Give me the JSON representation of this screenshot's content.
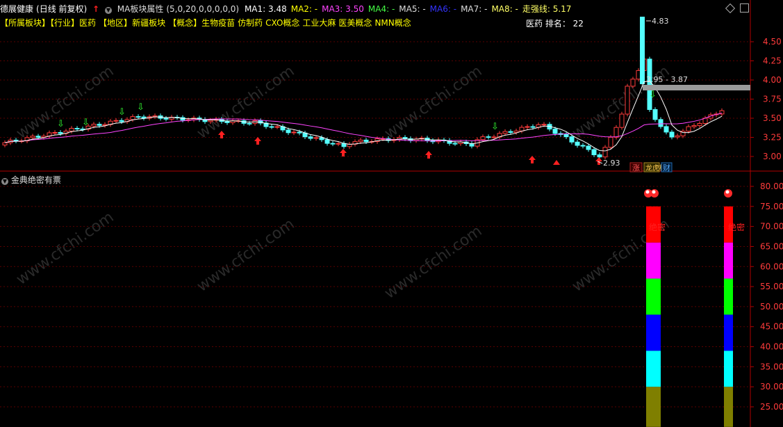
{
  "header": {
    "stock_name": "德展健康",
    "period_label": "(日线 前复权)",
    "indicator_name": "MA板块属性",
    "indicator_params": "(5,0,20,0,0,0,0,0)",
    "ma_readouts": [
      {
        "label": "MA1:",
        "value": "3.48",
        "color": "#ffffff"
      },
      {
        "label": "MA2:",
        "value": "-",
        "color": "#ffff00"
      },
      {
        "label": "MA3:",
        "value": "3.50",
        "color": "#ff44ff"
      },
      {
        "label": "MA4:",
        "value": "-",
        "color": "#44ff44"
      },
      {
        "label": "MA5:",
        "value": "-",
        "color": "#dddddd"
      },
      {
        "label": "MA6:",
        "value": "-",
        "color": "#3333ff"
      },
      {
        "label": "MA7:",
        "value": "-",
        "color": "#dddddd"
      },
      {
        "label": "MA8:",
        "value": "-",
        "color": "#ffff66"
      },
      {
        "label": "走强线:",
        "value": "5.17",
        "color": "#ffff66"
      }
    ]
  },
  "sector_bar": {
    "items": [
      {
        "text": "【所属板块】",
        "color": "#ffff00"
      },
      {
        "text": "【行业】",
        "color": "#ffff00"
      },
      {
        "text": "医药",
        "color": "#ffff00"
      },
      {
        "text": "【地区】",
        "color": "#ffff00"
      },
      {
        "text": "新疆板块",
        "color": "#ffff00"
      },
      {
        "text": "【概念】",
        "color": "#ffff00"
      },
      {
        "text": "生物疫苗",
        "color": "#ffff00"
      },
      {
        "text": "仿制药",
        "color": "#ffff00"
      },
      {
        "text": "CXO概念",
        "color": "#ffff00"
      },
      {
        "text": "工业大麻",
        "color": "#ffff00"
      },
      {
        "text": "医美概念",
        "color": "#ffff00"
      },
      {
        "text": "NMN概念",
        "color": "#ffff00"
      }
    ],
    "rank_label": "医药 排名： 22"
  },
  "main_chart": {
    "y_ticks": [
      "4.50",
      "4.25",
      "4.00",
      "3.75",
      "3.50",
      "3.25",
      "3.00"
    ],
    "high_label": "4.83",
    "low_label": "2.93",
    "range_label": "3.95 - 3.87",
    "badges": [
      {
        "text": "涨",
        "color": "#ff5555"
      },
      {
        "text": "龙虎榜",
        "color": "#ffcc55"
      },
      {
        "text": "财",
        "color": "#55aaff"
      }
    ]
  },
  "sub_chart": {
    "title": "金典绝密有票",
    "y_ticks": [
      "80.00",
      "75.00",
      "70.00",
      "65.00",
      "60.00",
      "55.00",
      "50.00",
      "45.00",
      "40.00",
      "35.00",
      "30.00",
      "25.00"
    ],
    "signal_label_1": "绝密",
    "signal_label_2": "绝密",
    "band_colors": [
      "#7f7f00",
      "#00ffff",
      "#0000ff",
      "#00ff00",
      "#ff00ff",
      "#ff0000"
    ]
  },
  "watermark": "www.cfchi.com"
}
